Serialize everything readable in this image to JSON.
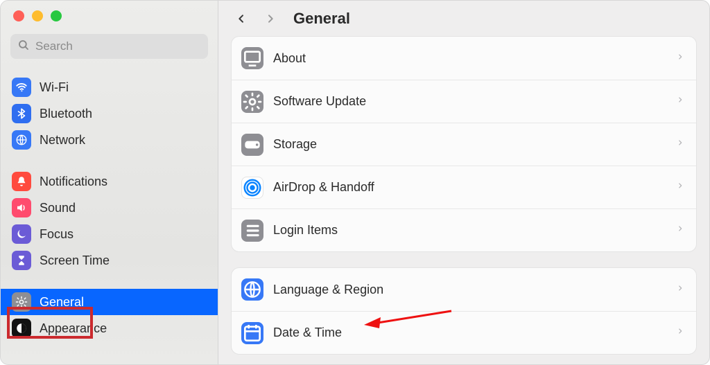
{
  "search": {
    "placeholder": "Search"
  },
  "header": {
    "title": "General"
  },
  "sidebar": {
    "wifi": "Wi-Fi",
    "bluetooth": "Bluetooth",
    "network": "Network",
    "notifications": "Notifications",
    "sound": "Sound",
    "focus": "Focus",
    "screentime": "Screen Time",
    "general": "General",
    "appearance": "Appearance"
  },
  "rows": {
    "about": "About",
    "software_update": "Software Update",
    "storage": "Storage",
    "airdrop": "AirDrop & Handoff",
    "login_items": "Login Items",
    "language_region": "Language & Region",
    "date_time": "Date & Time"
  }
}
